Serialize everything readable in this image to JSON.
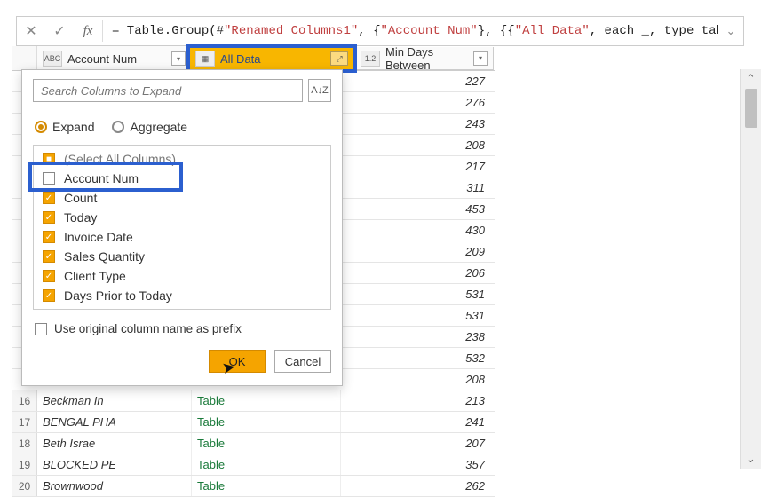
{
  "formula": {
    "prefix": "= Table.Group(#",
    "renamed": "\"Renamed Columns1\"",
    "mid1": ", {",
    "acct": "\"Account Num\"",
    "mid2": "}, {{",
    "alldata": "\"All Data\"",
    "mid3": ", each _, type table [Account"
  },
  "columns": {
    "col1_type": "ABC",
    "col1_label": "Account Num",
    "col2_label": "All Data",
    "col3_type": "1.2",
    "col3_label": "Min Days Between"
  },
  "popup": {
    "search_placeholder": "Search Columns to Expand",
    "sort_hint": "A↓Z",
    "expand_label": "Expand",
    "aggregate_label": "Aggregate",
    "select_all": "(Select All Columns)",
    "items": [
      {
        "label": "Account Num",
        "checked": false
      },
      {
        "label": "Count",
        "checked": true
      },
      {
        "label": "Today",
        "checked": true
      },
      {
        "label": "Invoice Date",
        "checked": true
      },
      {
        "label": "Sales Quantity",
        "checked": true
      },
      {
        "label": "Client Type",
        "checked": true
      },
      {
        "label": "Days Prior to Today",
        "checked": true
      }
    ],
    "prefix_label": "Use original column name as prefix",
    "ok": "OK",
    "cancel": "Cancel"
  },
  "rows": [
    {
      "n": "",
      "name": "",
      "link": "",
      "days": "227"
    },
    {
      "n": "",
      "name": "",
      "link": "",
      "days": "276"
    },
    {
      "n": "",
      "name": "",
      "link": "",
      "days": "243"
    },
    {
      "n": "",
      "name": "",
      "link": "",
      "days": "208"
    },
    {
      "n": "",
      "name": "",
      "link": "",
      "days": "217"
    },
    {
      "n": "",
      "name": "",
      "link": "",
      "days": "311"
    },
    {
      "n": "",
      "name": "",
      "link": "",
      "days": "453"
    },
    {
      "n": "",
      "name": "",
      "link": "",
      "days": "430"
    },
    {
      "n": "",
      "name": "",
      "link": "",
      "days": "209"
    },
    {
      "n": "",
      "name": "",
      "link": "",
      "days": "206"
    },
    {
      "n": "",
      "name": "",
      "link": "",
      "days": "531"
    },
    {
      "n": "",
      "name": "",
      "link": "",
      "days": "531"
    },
    {
      "n": "",
      "name": "",
      "link": "",
      "days": "238"
    },
    {
      "n": "",
      "name": "",
      "link": "",
      "days": "532"
    },
    {
      "n": "",
      "name": "",
      "link": "",
      "days": "208"
    },
    {
      "n": "16",
      "name": "Beckman In",
      "link": "Table",
      "days": "213"
    },
    {
      "n": "17",
      "name": "BENGAL PHA",
      "link": "Table",
      "days": "241"
    },
    {
      "n": "18",
      "name": "Beth Israe",
      "link": "Table",
      "days": "207"
    },
    {
      "n": "19",
      "name": "BLOCKED PE",
      "link": "Table",
      "days": "357"
    },
    {
      "n": "20",
      "name": "Brownwood",
      "link": "Table",
      "days": "262"
    }
  ]
}
